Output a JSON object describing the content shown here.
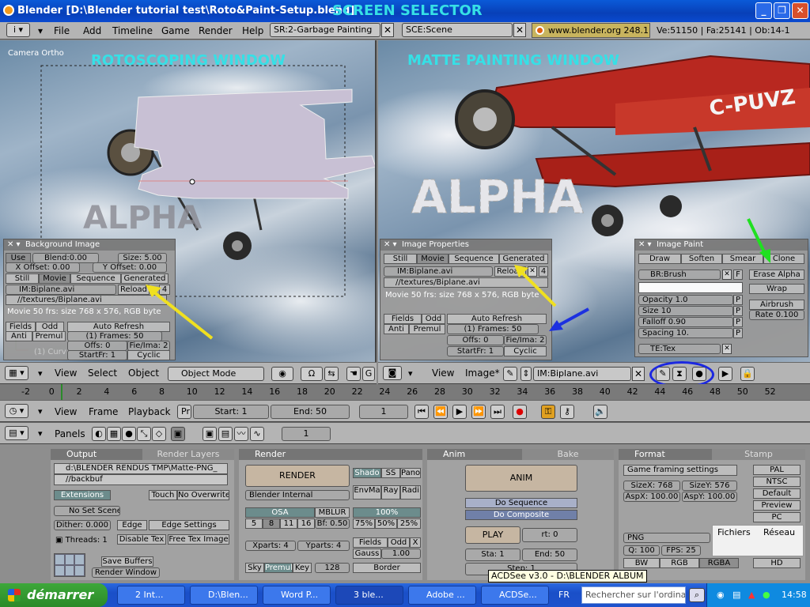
{
  "window": {
    "title": "Blender [D:\\Blender tutorial test\\Roto&Paint-Setup.blend]",
    "annotation_screen_selector": "SCREEN SELECTOR",
    "minimize": "_",
    "maximize": "❐",
    "close": "✕"
  },
  "menubar": {
    "items": [
      "File",
      "Add",
      "Timeline",
      "Game",
      "Render",
      "Help"
    ],
    "screen": "SR:2-Garbage Painting",
    "scene": "SCE:Scene",
    "url": "www.blender.org 248.1",
    "stats": "Ve:51150 | Fa:25141 | Ob:14-1"
  },
  "left_view": {
    "camera_label": "Camera Ortho",
    "annotation": "ROTOSCOPING WINDOW",
    "alpha_text": "ALPHA",
    "bg_panel": {
      "title": "Background Image",
      "use": "Use",
      "blend": "Blend:0.00",
      "size": "Size: 5.00",
      "x_offset": "X Offset: 0.00",
      "y_offset": "Y Offset: 0.00",
      "tabs": [
        "Still",
        "Movie",
        "Sequence",
        "Generated"
      ],
      "image": "IM:Biplane.avi",
      "reload": "Reload",
      "users": "4",
      "path": "//textures/Biplane.avi",
      "info": "Movie 50 frs: size 768 x 576, RGB byte",
      "fields": "Fields",
      "odd": "Odd",
      "auto_refresh": "Auto Refresh",
      "anti": "Anti",
      "premul": "Premul",
      "frames": "(1) Frames: 50",
      "offs": "Offs: 0",
      "fie_ima": "Fie/Ima: 2",
      "startfr": "StartFr: 1",
      "cyclic": "Cyclic",
      "curve": "(1) Curv"
    },
    "header": {
      "view": "View",
      "select": "Select",
      "object": "Object",
      "mode": "Object Mode"
    }
  },
  "right_view": {
    "annotation": "MATTE PAINTING WINDOW",
    "alpha_text": "ALPHA",
    "plane_code": "C-PUVZ",
    "img_panel": {
      "title": "Image Properties",
      "tabs": [
        "Still",
        "Movie",
        "Sequence",
        "Generated"
      ],
      "image": "IM:Biplane.avi",
      "reload": "Reload",
      "users": "4",
      "path": "//textures/Biplane.avi",
      "info": "Movie 50 frs: size 768 x 576, RGB byte",
      "fields": "Fields",
      "odd": "Odd",
      "auto_refresh": "Auto Refresh",
      "anti": "Anti",
      "premul": "Premul",
      "frames": "(1) Frames: 50",
      "offs": "Offs: 0",
      "fie_ima": "Fie/Ima: 2",
      "startfr": "StartFr: 1",
      "cyclic": "Cyclic"
    },
    "paint_panel": {
      "title": "Image Paint",
      "tabs": [
        "Draw",
        "Soften",
        "Smear",
        "Clone"
      ],
      "brush": "BR:Brush",
      "f": "F",
      "erase_alpha": "Erase Alpha",
      "opacity": "Opacity 1.0",
      "size": "Size 10",
      "falloff": "Falloff 0.90",
      "spacing": "Spacing 10.",
      "p": "P",
      "wrap": "Wrap",
      "airbrush": "Airbrush",
      "rate": "Rate 0.100",
      "tex": "TE:Tex"
    },
    "header": {
      "view": "View",
      "image": "Image*",
      "image_block": "IM:Biplane.avi"
    }
  },
  "timeline": {
    "ticks": [
      "-2",
      "0",
      "2",
      "4",
      "6",
      "8",
      "10",
      "12",
      "14",
      "16",
      "18",
      "20",
      "22",
      "24",
      "26",
      "28",
      "30",
      "32",
      "34",
      "36",
      "38",
      "40",
      "42",
      "44",
      "46",
      "48",
      "50",
      "52"
    ],
    "view": "View",
    "frame": "Frame",
    "playback": "Playback",
    "pr": "Pr",
    "start": "Start: 1",
    "end": "End: 50",
    "current": "1"
  },
  "buttons": {
    "panels_label": "Panels",
    "frame_num": "1",
    "output": {
      "tab": "Output",
      "tab2": "Render Layers",
      "path1": "d:\\BLENDER RENDUS TMP\\Matte-PNG_",
      "path2": "//backbuf",
      "extensions": "Extensions",
      "touch": "Touch",
      "no_overwrite": "No Overwrite",
      "no_set_scene": "No Set Scene",
      "dither": "Dither: 0.000",
      "edge": "Edge",
      "edge_settings": "Edge Settings",
      "threads": "Threads: 1",
      "disable_tex": "Disable Tex",
      "free_tex": "Free Tex Image",
      "save_buffers": "Save Buffers",
      "render_window": "Render Window"
    },
    "render": {
      "tab": "Render",
      "render_btn": "RENDER",
      "shado": "Shado",
      "ss": "SS",
      "pano": "Pano",
      "engine": "Blender Internal",
      "envma": "EnvMa",
      "ray": "Ray",
      "radi": "Radi",
      "osa": "OSA",
      "mblur": "MBLUR",
      "pct100": "100%",
      "osa_vals": [
        "5",
        "8",
        "11",
        "16"
      ],
      "bf": "Bf: 0.50",
      "pcts": [
        "75%",
        "50%",
        "25%"
      ],
      "xparts": "Xparts: 4",
      "yparts": "Yparts: 4",
      "fields": "Fields",
      "odd": "Odd",
      "x": "X",
      "gauss": "Gauss",
      "gauss_val": "1.00",
      "sky": "Sky",
      "premul": "Premul",
      "key": "Key",
      "bits": "128",
      "border": "Border"
    },
    "anim": {
      "tab": "Anim",
      "tab2": "Bake",
      "anim_btn": "ANIM",
      "do_sequence": "Do Sequence",
      "do_composite": "Do Composite",
      "play": "PLAY",
      "rt": "rt: 0",
      "sta": "Sta: 1",
      "end": "End: 50",
      "step": "Step: 1"
    },
    "format": {
      "tab": "Format",
      "tab2": "Stamp",
      "game_framing": "Game framing settings",
      "sizex": "SizeX: 768",
      "sizey": "SizeY: 576",
      "aspx": "AspX: 100.00",
      "aspy": "AspY: 100.00",
      "presets": [
        "PAL",
        "NTSC",
        "Default",
        "Preview",
        "PC"
      ],
      "format": "PNG",
      "q": "Q: 100",
      "fps": "FPS: 25",
      "bw": "BW",
      "rgb": "RGB",
      "rgba": "RGBA",
      "hd": "HD",
      "fichiers": "Fichiers",
      "reseau": "Réseau"
    }
  },
  "tooltip": "ACDSee v3.0 - D:\\BLENDER ALBUM",
  "taskbar": {
    "start": "démarrer",
    "tasks": [
      "2 Int...",
      "D:\\Blen...",
      "Word P...",
      "3 ble...",
      "Adobe ...",
      "ACDSe..."
    ],
    "lang": "FR",
    "search": "Rechercher sur l'ordinateur",
    "time": "14:58"
  }
}
